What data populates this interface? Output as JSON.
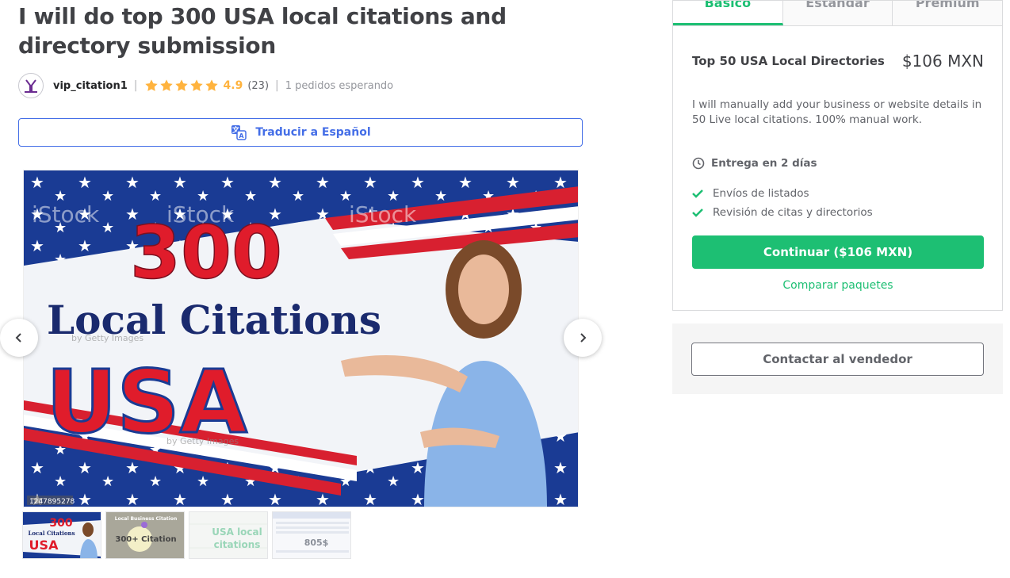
{
  "gig": {
    "title": "I will do top 300 USA local citations and directory submission",
    "seller_name": "vip_citation1",
    "rating": "4.9",
    "reviews": "(23)",
    "queue": "1 pedidos esperando",
    "translate_label": "Traducir a Español"
  },
  "gallery": {
    "main_image": {
      "headline_number": "300",
      "headline_text": "Local Citations",
      "country_text": "USA",
      "watermark": "iStock",
      "watermark_sub": "by Getty Images",
      "stock_id": "1247895278"
    },
    "thumbnails": [
      {
        "line1": "300",
        "line2": "Local Citations",
        "line3": "USA"
      },
      {
        "line1": "Local Business Citation",
        "line2": "300+ Citation"
      },
      {
        "line1": "USA local",
        "line2": "citations"
      },
      {
        "line1": "805$"
      }
    ]
  },
  "package": {
    "tabs": [
      {
        "label": "Básico",
        "active": true
      },
      {
        "label": "Estándar",
        "active": false
      },
      {
        "label": "Premium",
        "active": false
      }
    ],
    "name": "Top 50 USA Local Directories",
    "price": "$106 MXN",
    "description": "I will manually add your business or website details in 50 Live local citations. 100% manual work.",
    "delivery": "Entrega en 2 días",
    "features": [
      "Envíos de listados",
      "Revisión de citas y directorios"
    ],
    "continue_label": "Continuar ($106 MXN)",
    "compare_label": "Comparar paquetes"
  },
  "contact": {
    "label": "Contactar al vendedor"
  },
  "colors": {
    "accent": "#1dbf73",
    "link": "#446ee7",
    "star": "#ffb33e"
  }
}
